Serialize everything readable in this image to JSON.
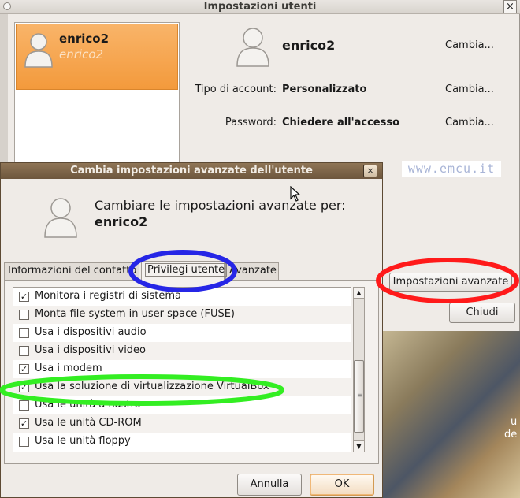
{
  "users_window": {
    "title": "Impostazioni utenti",
    "close_glyph": "×",
    "user_list": [
      {
        "name": "enrico2",
        "subtitle": "enrico2"
      }
    ],
    "detail": {
      "name": "enrico2",
      "change_label": "Cambia...",
      "account_type_label": "Tipo di account:",
      "account_type_value": "Personalizzato",
      "password_label": "Password:",
      "password_value": "Chiedere all'accesso"
    },
    "advanced_button_label": "Impostazioni avanzate",
    "close_button_label": "Chiudi"
  },
  "watermark": "www.emcu.it",
  "wallpaper_text": [
    "u",
    "de"
  ],
  "dialog": {
    "title": "Cambia impostazioni avanzate dell'utente",
    "close_glyph": "×",
    "heading": "Cambiare le impostazioni avanzate per:",
    "user": "enrico2",
    "tabs": [
      {
        "label": "Informazioni del contatto"
      },
      {
        "label": "Privilegi utente"
      },
      {
        "label": "Avanzate"
      }
    ],
    "privileges": [
      {
        "label": "Monitora i registri di sistema",
        "checked": true
      },
      {
        "label": "Monta file system in user space (FUSE)",
        "checked": false
      },
      {
        "label": "Usa i dispositivi audio",
        "checked": false
      },
      {
        "label": "Usa i dispositivi video",
        "checked": false
      },
      {
        "label": "Usa i modem",
        "checked": true
      },
      {
        "label": "Usa la soluzione di virtualizzazione VirtualBox",
        "checked": true
      },
      {
        "label": "Usa le unità a nastro",
        "checked": false
      },
      {
        "label": "Usa le unità CD-ROM",
        "checked": true
      },
      {
        "label": "Usa le unità floppy",
        "checked": false
      }
    ],
    "check_glyph": "✓",
    "scroll_up_glyph": "▲",
    "scroll_down_glyph": "▼",
    "cancel_label": "Annulla",
    "ok_label": "OK"
  },
  "colors": {
    "selection_orange": "#f39a3c",
    "dialog_titlebar": "#7a6247",
    "highlight_blue": "#2626e6",
    "highlight_red": "#ff1a1a",
    "highlight_green": "#33ee22"
  },
  "icons": {
    "user_avatar": "person-silhouette-icon",
    "cursor": "arrow-cursor-icon"
  }
}
